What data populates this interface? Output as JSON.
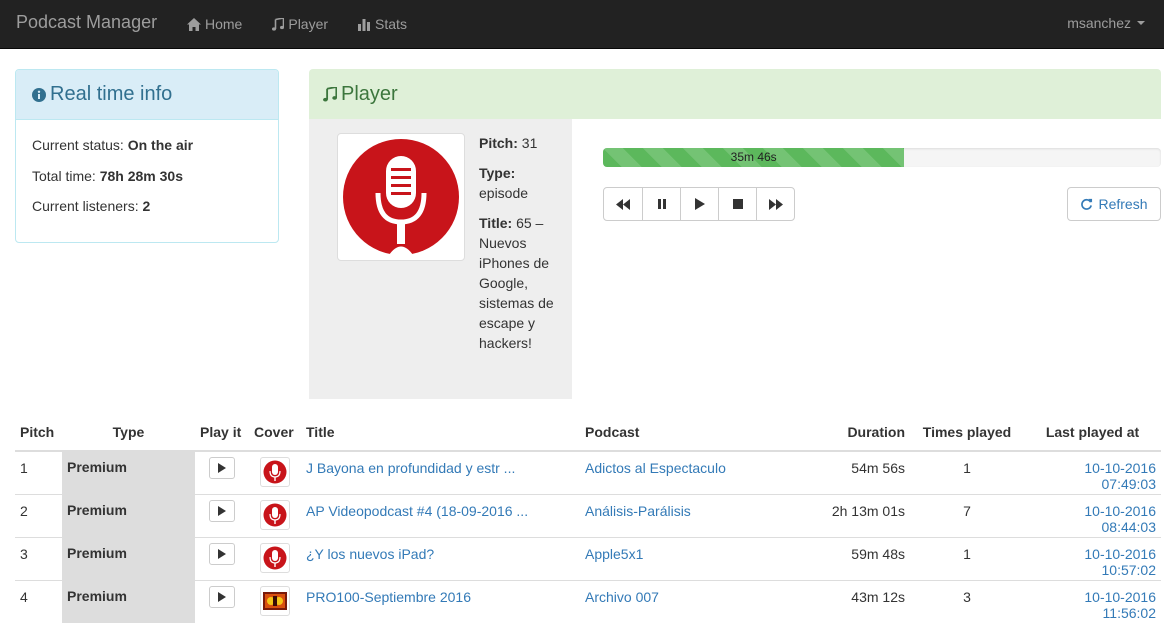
{
  "navbar": {
    "brand": "Podcast Manager",
    "items": [
      {
        "label": "Home",
        "icon": "home-icon"
      },
      {
        "label": "Player",
        "icon": "music-icon"
      },
      {
        "label": "Stats",
        "icon": "stats-icon"
      }
    ],
    "user": "msanchez"
  },
  "info_panel": {
    "title": "Real time info",
    "status_label": "Current status:",
    "status_value": "On the air",
    "total_label": "Total time:",
    "total_value": "78h 28m 30s",
    "listeners_label": "Current listeners:",
    "listeners_value": "2"
  },
  "player": {
    "title": "Player",
    "pitch_label": "Pitch:",
    "pitch_value": "31",
    "type_label": "Type:",
    "type_value": "episode",
    "title_label": "Title:",
    "title_value": "65 – Nuevos iPhones de Google, sistemas de escape y hackers!",
    "progress_label": "35m 46s",
    "progress_fraction": 0.54,
    "refresh_label": "Refresh",
    "controls": [
      "backward-icon",
      "pause-icon",
      "play-icon",
      "stop-icon",
      "forward-icon"
    ]
  },
  "table": {
    "headers": {
      "pitch": "Pitch",
      "type": "Type",
      "play": "Play it",
      "cover": "Cover",
      "title": "Title",
      "podcast": "Podcast",
      "duration": "Duration",
      "times": "Times played",
      "last": "Last played at"
    },
    "rows": [
      {
        "pitch": "1",
        "type": "Premium",
        "title": "J Bayona en profundidad y estr ...",
        "podcast": "Adictos al Espectaculo",
        "duration": "54m 56s",
        "times": "1",
        "last": "10-10-2016 07:49:03",
        "cover": "mic"
      },
      {
        "pitch": "2",
        "type": "Premium",
        "title": "AP Videopodcast #4 (18-09-2016 ...",
        "podcast": "Análisis-Parálisis",
        "duration": "2h 13m 01s",
        "times": "7",
        "last": "10-10-2016 08:44:03",
        "cover": "mic"
      },
      {
        "pitch": "3",
        "type": "Premium",
        "title": "¿Y los nuevos iPad?",
        "podcast": "Apple5x1",
        "duration": "59m 48s",
        "times": "1",
        "last": "10-10-2016 10:57:02",
        "cover": "mic"
      },
      {
        "pitch": "4",
        "type": "Premium",
        "title": "PRO100-Septiembre 2016",
        "podcast": "Archivo 007",
        "duration": "43m 12s",
        "times": "3",
        "last": "10-10-2016 11:56:02",
        "cover": "art"
      }
    ]
  }
}
